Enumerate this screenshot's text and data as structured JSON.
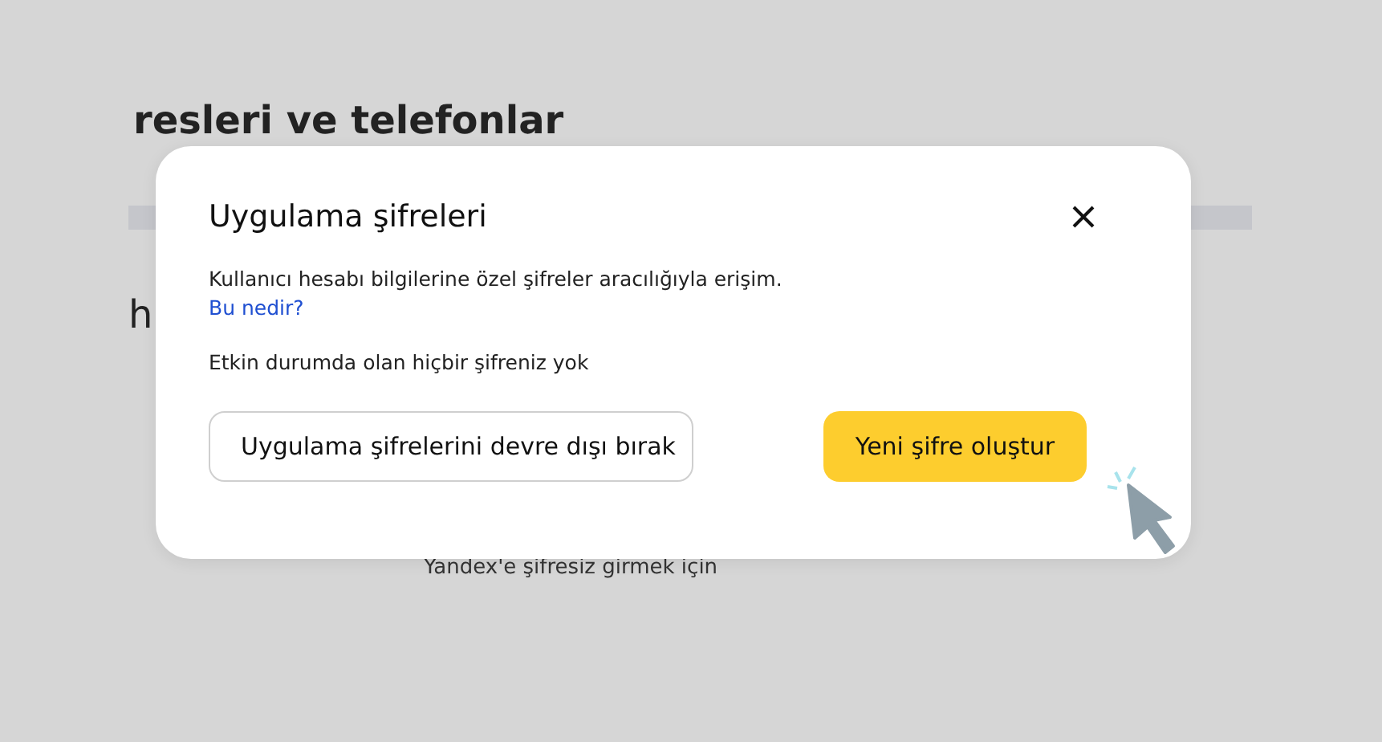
{
  "page": {
    "heading": "resleri ve telefonlar",
    "section_heading": "h",
    "caption": "Yandex'e şifresiz girmek için"
  },
  "dialog": {
    "title": "Uygulama şifreleri",
    "description": "Kullanıcı hesabı bilgilerine özel şifreler aracılığıyla erişim.",
    "link": "Bu nedir?",
    "status": "Etkin durumda olan hiçbir şifreniz yok",
    "buttons": [
      {
        "label": "Uygulama şifrelerini devre dışı bırak",
        "kind": "secondary"
      },
      {
        "label": "Yeni şifre oluştur",
        "kind": "primary"
      }
    ]
  }
}
